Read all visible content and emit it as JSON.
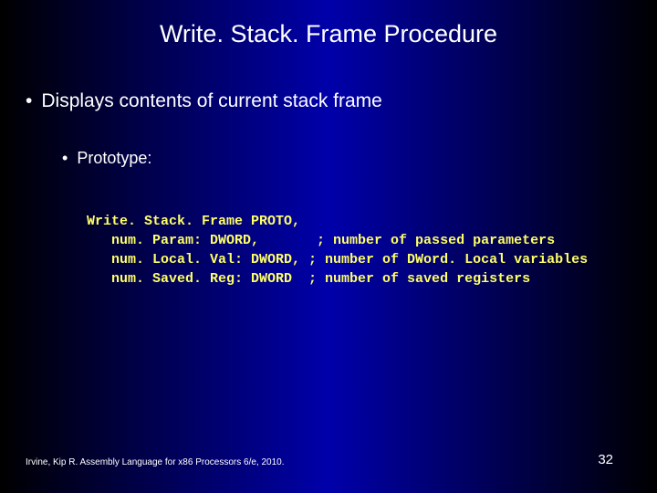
{
  "title": "Write. Stack. Frame Procedure",
  "bullets": {
    "b1": "Displays contents of current stack frame",
    "b2": "Prototype:"
  },
  "code": "Write. Stack. Frame PROTO,\n   num. Param: DWORD,       ; number of passed parameters\n   num. Local. Val: DWORD, ; number of DWord. Local variables\n   num. Saved. Reg: DWORD  ; number of saved registers",
  "footer": "Irvine, Kip R. Assembly Language for x86 Processors 6/e, 2010.",
  "page": "32"
}
